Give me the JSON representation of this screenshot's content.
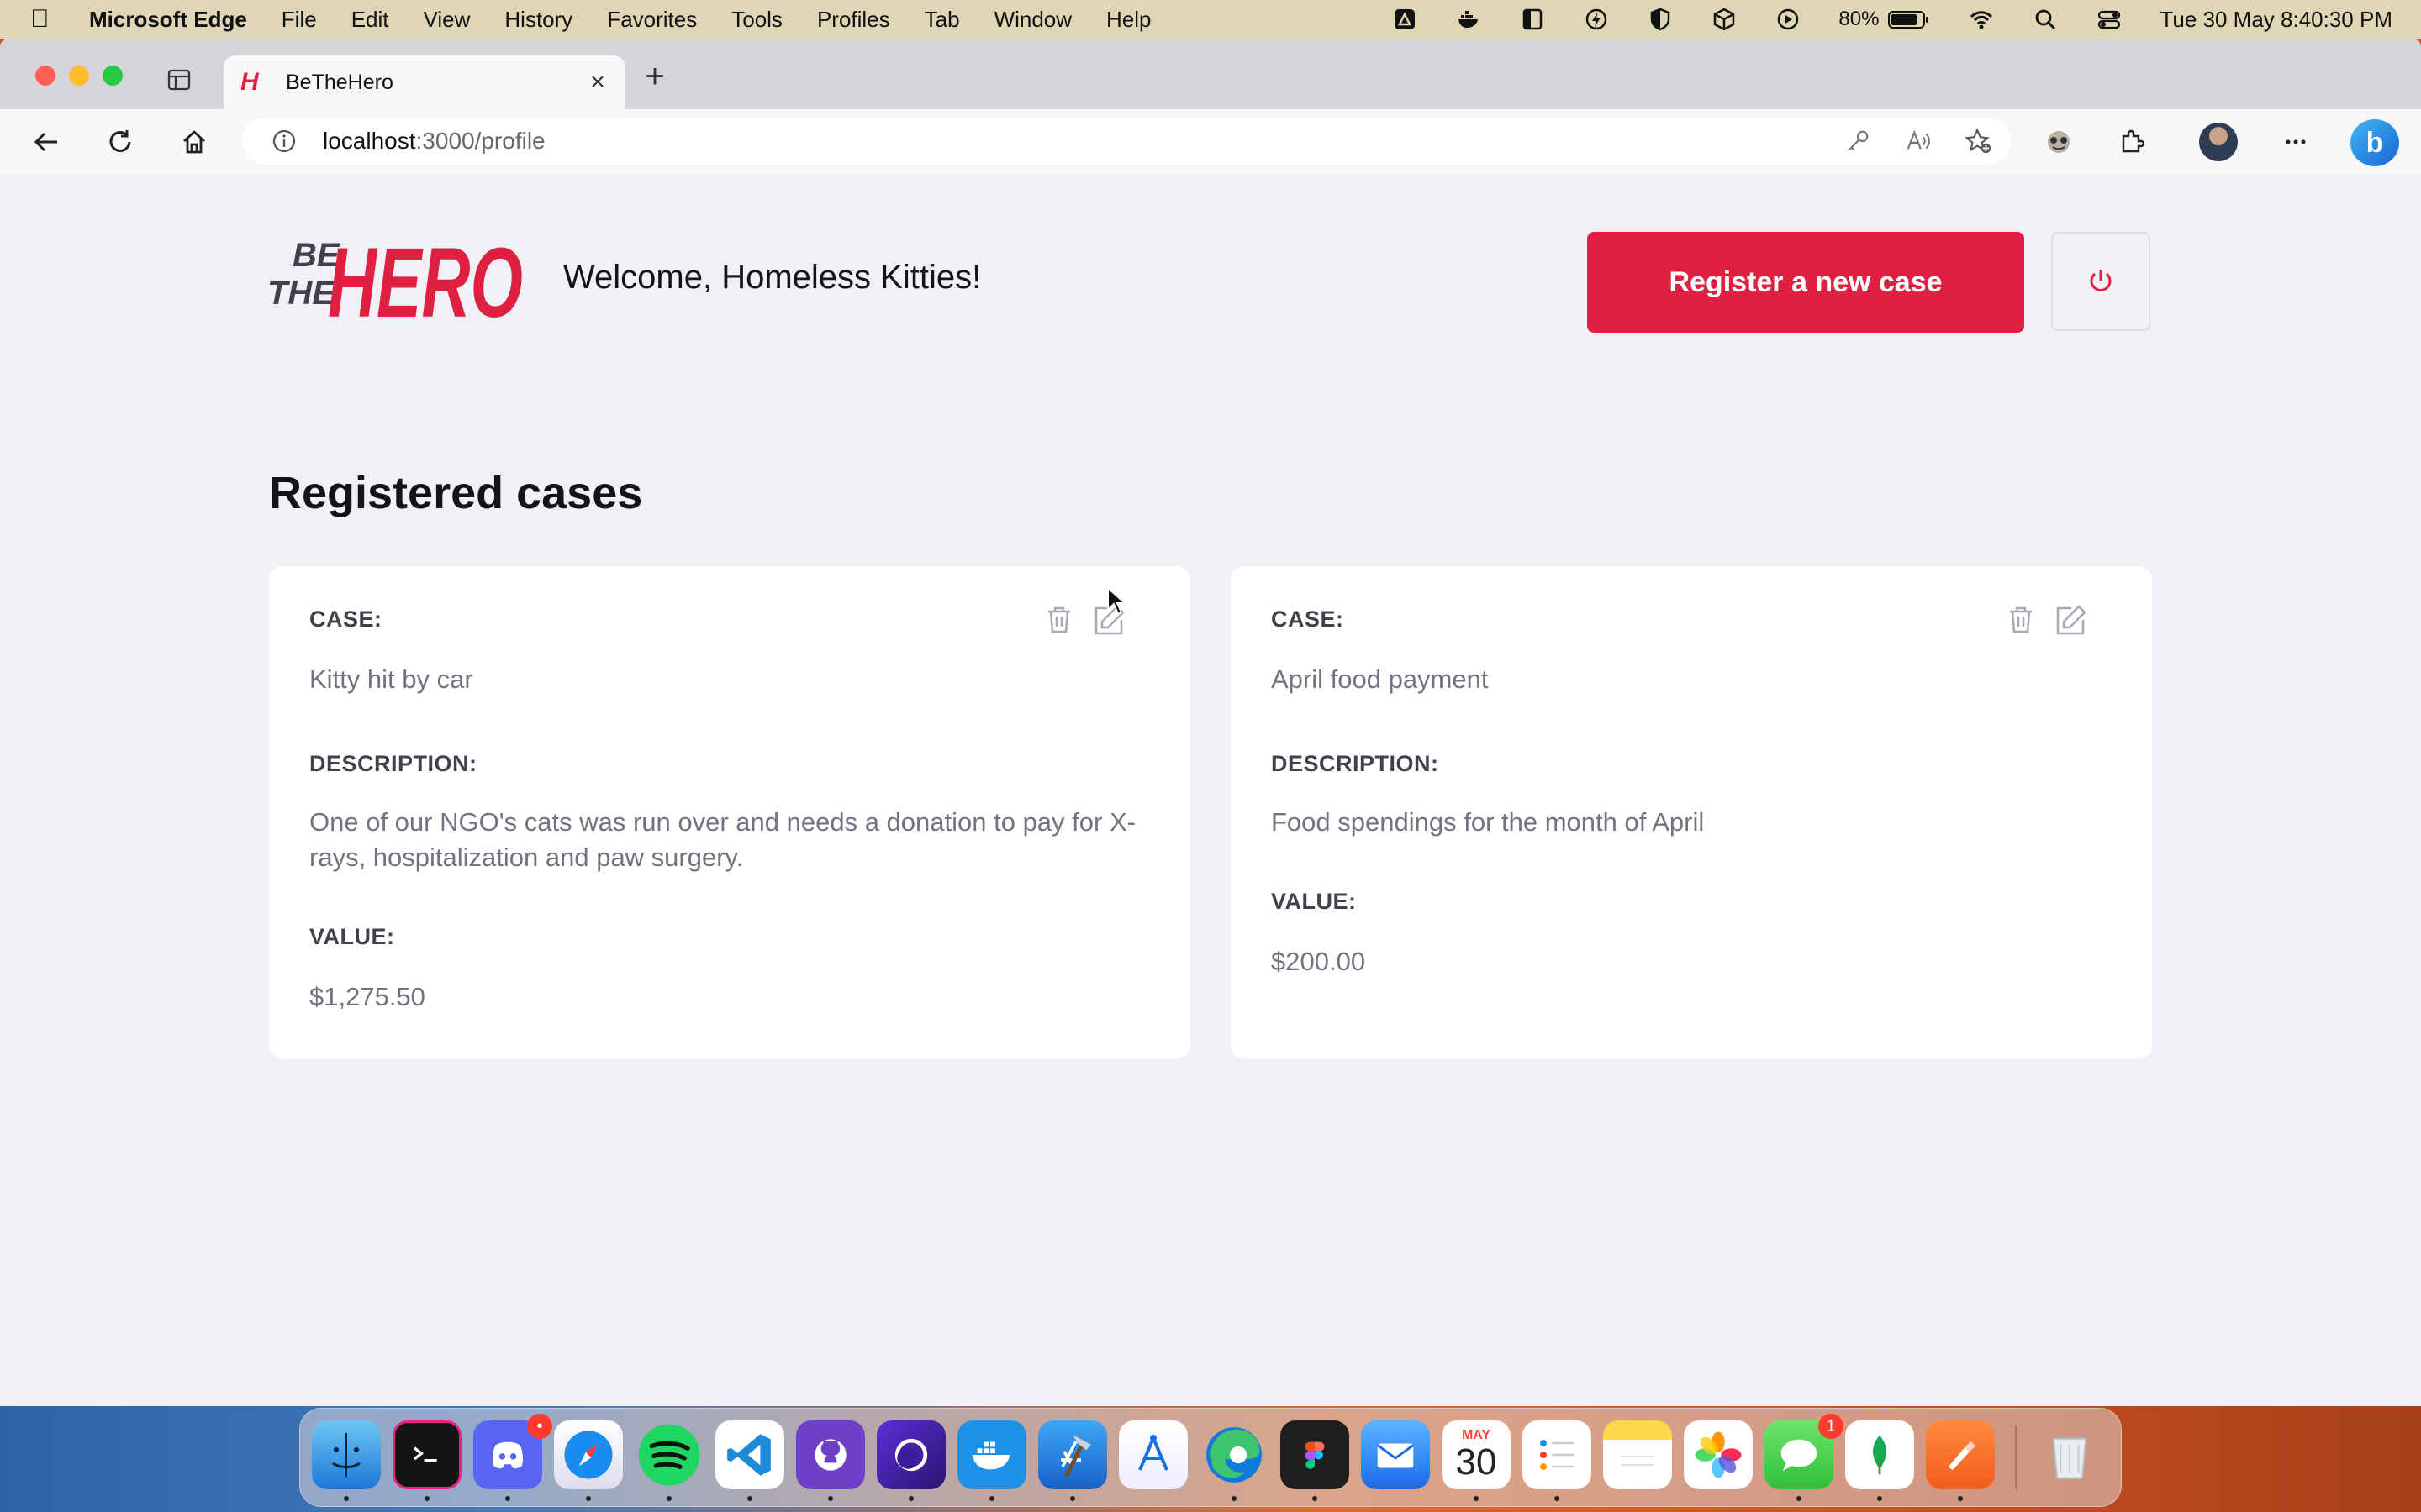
{
  "menubar": {
    "app_name": "Microsoft Edge",
    "menus": [
      "File",
      "Edit",
      "View",
      "History",
      "Favorites",
      "Tools",
      "Profiles",
      "Tab",
      "Window",
      "Help"
    ],
    "battery": "80%",
    "clock": "Tue 30 May  8:40:30 PM"
  },
  "browser": {
    "tab_title": "BeTheHero",
    "url_host": "localhost",
    "url_path": ":3000/profile"
  },
  "page": {
    "logo_top": "BE",
    "logo_mid": "THE",
    "logo_main": "HERO",
    "welcome": "Welcome, Homeless Kitties!",
    "register_label": "Register a new case",
    "section_title": "Registered cases",
    "brand_color": "#e02041",
    "cases": [
      {
        "case_label": "CASE:",
        "case_value": "Kitty hit by car",
        "description_label": "DESCRIPTION:",
        "description_value": "One of our NGO's cats was run over and needs a donation to pay for X-rays, hospitalization and paw surgery.",
        "value_label": "VALUE:",
        "value": "$1,275.50"
      },
      {
        "case_label": "CASE:",
        "case_value": "April food payment",
        "description_label": "DESCRIPTION:",
        "description_value": "Food spendings for the month of April",
        "value_label": "VALUE:",
        "value": "$200.00"
      }
    ]
  },
  "dock": {
    "calendar_month": "MAY",
    "calendar_day": "30",
    "discord_badge": "•",
    "messages_badge": "1"
  }
}
